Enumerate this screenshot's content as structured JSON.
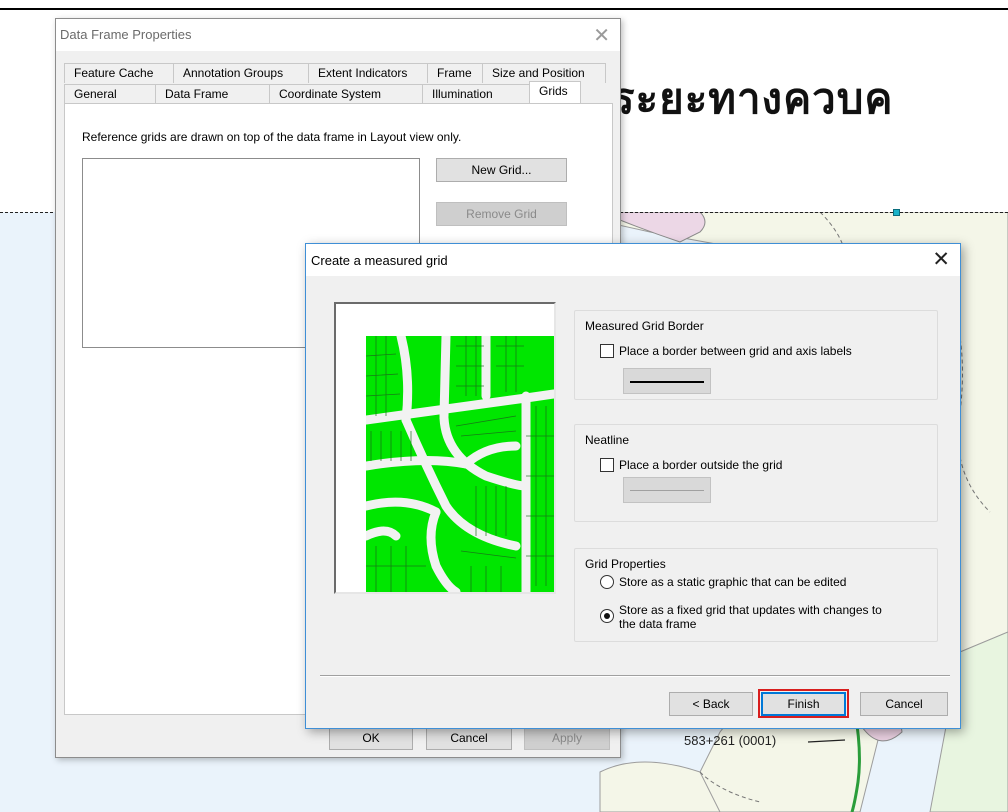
{
  "slide": {
    "title_fragment": "ระยะทางควบค"
  },
  "map": {
    "label": "583+261 (0001)"
  },
  "data_frame_properties": {
    "title": "Data Frame Properties",
    "tabs_row1": [
      "Feature Cache",
      "Annotation Groups",
      "Extent Indicators",
      "Frame",
      "Size and Position"
    ],
    "tabs_row2": [
      "General",
      "Data Frame",
      "Coordinate System",
      "Illumination",
      "Grids"
    ],
    "active_tab": "Grids",
    "description": "Reference grids are drawn on top of the data frame in Layout view only.",
    "new_grid_label": "New Grid...",
    "remove_grid_label": "Remove Grid",
    "ok_label": "OK",
    "cancel_label": "Cancel",
    "apply_label": "Apply"
  },
  "measured_grid_dialog": {
    "title": "Create a measured grid",
    "border_group": {
      "title": "Measured Grid Border",
      "checkbox_label": "Place a border between grid and axis labels",
      "checked": false
    },
    "neatline_group": {
      "title": "Neatline",
      "checkbox_label": "Place a border outside the grid",
      "checked": false
    },
    "properties_group": {
      "title": "Grid Properties",
      "option_static": "Store as a static graphic that can be edited",
      "option_fixed_line1": "Store as a fixed grid that updates with changes to",
      "option_fixed_line2": "the data frame",
      "selected": "fixed"
    },
    "back_label": "< Back",
    "finish_label": "Finish",
    "cancel_label": "Cancel"
  },
  "colors": {
    "preview_fill": "#00e600",
    "highlight": "#d81e1e",
    "map_water": "#eaf3fb",
    "route_line": "#2a9d3a"
  }
}
